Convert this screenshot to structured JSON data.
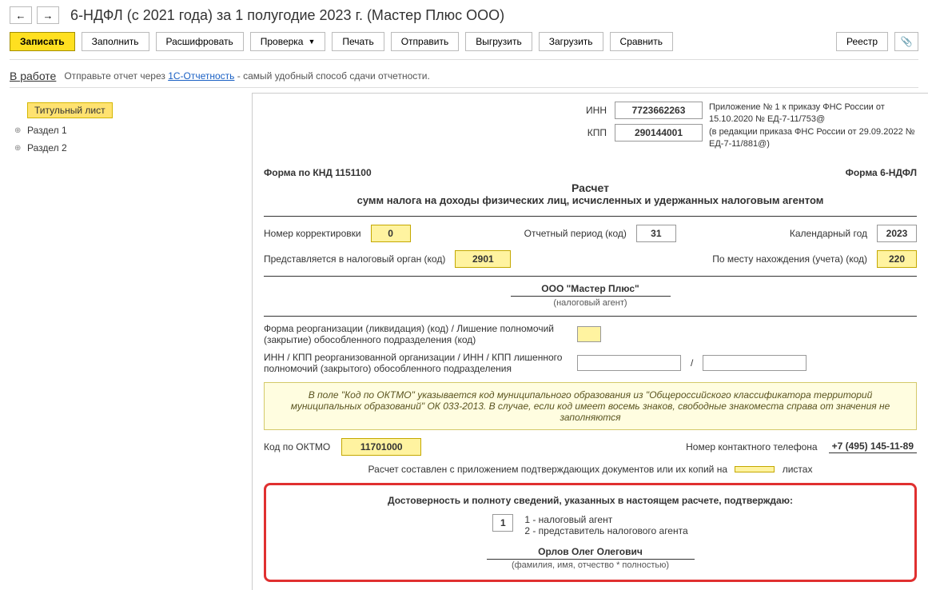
{
  "header": {
    "title": "6-НДФЛ (с 2021 года) за 1 полугодие 2023 г. (Мастер Плюс ООО)"
  },
  "buttons": {
    "save": "Записать",
    "fill": "Заполнить",
    "decode": "Расшифровать",
    "check": "Проверка",
    "print": "Печать",
    "send": "Отправить",
    "export": "Выгрузить",
    "import": "Загрузить",
    "compare": "Сравнить",
    "registry": "Реестр"
  },
  "status": {
    "state": "В работе",
    "hint_prefix": "Отправьте отчет через ",
    "hint_link": "1С-Отчетность",
    "hint_suffix": " - самый удобный способ сдачи отчетности."
  },
  "tree": {
    "title_sheet": "Титульный лист",
    "section1": "Раздел 1",
    "section2": "Раздел 2"
  },
  "form": {
    "inn_label": "ИНН",
    "inn": "7723662263",
    "kpp_label": "КПП",
    "kpp": "290144001",
    "decree1": "Приложение № 1 к приказу ФНС России от 15.10.2020 № ЕД-7-11/753@",
    "decree2": "(в редакции приказа ФНС России от 29.09.2022 № ЕД-7-11/881@)",
    "knd": "Форма по КНД 1151100",
    "form_name": "Форма 6-НДФЛ",
    "calc_title": "Расчет",
    "calc_sub": "сумм налога на доходы физических лиц, исчисленных и удержанных налоговым агентом",
    "corr_label": "Номер корректировки",
    "corr": "0",
    "period_label": "Отчетный период (код)",
    "period": "31",
    "year_label": "Календарный год",
    "year": "2023",
    "tax_org_label": "Представляется в налоговый орган (код)",
    "tax_org": "2901",
    "place_label": "По месту нахождения (учета) (код)",
    "place": "220",
    "org_name": "ООО \"Мастер Плюс\"",
    "org_sub": "(налоговый агент)",
    "reorg_label": "Форма реорганизации (ликвидация) (код) / Лишение полномочий (закрытие) обособленного подразделения (код)",
    "reorg_inn_label": "ИНН / КПП реорганизованной организации / ИНН / КПП лишенного полномочий (закрытого) обособленного подразделения",
    "slash": "/",
    "note": "В поле \"Код по ОКТМО\" указывается код муниципального образования из \"Общероссийского классификатора территорий муниципальных образований\" ОК 033-2013. В случае, если код имеет восемь знаков, свободные знакоместа справа от значения не заполняются",
    "oktmo_label": "Код по ОКТМО",
    "oktmo": "11701000",
    "phone_label": "Номер контактного телефона",
    "phone": "+7 (495) 145-11-89",
    "sheets_text_a": "Расчет составлен с приложением подтверждающих документов или их копий на",
    "sheets_text_b": "листах",
    "confirm_title": "Достоверность и полноту сведений, указанных в настоящем расчете, подтверждаю:",
    "confirm_code": "1",
    "confirm_opt1": "1 - налоговый агент",
    "confirm_opt2": "2 - представитель налогового агента",
    "signer": "Орлов Олег Олегович",
    "signer_sub": "(фамилия, имя, отчество * полностью)"
  }
}
